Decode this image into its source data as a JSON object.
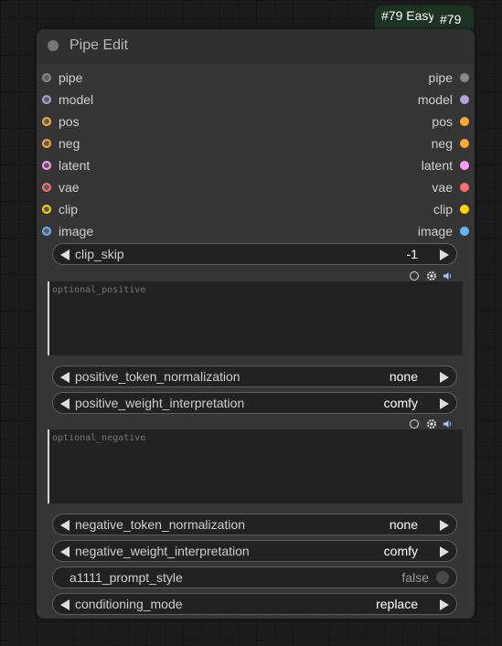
{
  "badge": {
    "text": "#79 Easy",
    "id": "#79"
  },
  "node": {
    "title": "Pipe Edit",
    "inputs": [
      {
        "label": "pipe",
        "color": "#888888"
      },
      {
        "label": "model",
        "color": "#b39ddb"
      },
      {
        "label": "pos",
        "color": "#ffa931"
      },
      {
        "label": "neg",
        "color": "#ffa931"
      },
      {
        "label": "latent",
        "color": "#ff9cf9"
      },
      {
        "label": "vae",
        "color": "#ff6e6e"
      },
      {
        "label": "clip",
        "color": "#ffd500"
      },
      {
        "label": "image",
        "color": "#64b5f6"
      }
    ],
    "outputs": [
      {
        "label": "pipe",
        "color": "#888888"
      },
      {
        "label": "model",
        "color": "#b39ddb"
      },
      {
        "label": "pos",
        "color": "#ffa931"
      },
      {
        "label": "neg",
        "color": "#ffa931"
      },
      {
        "label": "latent",
        "color": "#ff9cf9"
      },
      {
        "label": "vae",
        "color": "#ff6e6e"
      },
      {
        "label": "clip",
        "color": "#ffd500"
      },
      {
        "label": "image",
        "color": "#64b5f6"
      }
    ],
    "widgets": {
      "clip_skip": {
        "label": "clip_skip",
        "value": "-1"
      },
      "optional_positive": {
        "placeholder": "optional_positive"
      },
      "positive_token_normalization": {
        "label": "positive_token_normalization",
        "value": "none"
      },
      "positive_weight_interpretation": {
        "label": "positive_weight_interpretation",
        "value": "comfy"
      },
      "optional_negative": {
        "placeholder": "optional_negative"
      },
      "negative_token_normalization": {
        "label": "negative_token_normalization",
        "value": "none"
      },
      "negative_weight_interpretation": {
        "label": "negative_weight_interpretation",
        "value": "comfy"
      },
      "a1111_prompt_style": {
        "label": "a1111_prompt_style",
        "value": "false"
      },
      "conditioning_mode": {
        "label": "conditioning_mode",
        "value": "replace"
      }
    },
    "textarea_icons": [
      "circle-icon",
      "gear-icon",
      "speaker-icon"
    ]
  }
}
